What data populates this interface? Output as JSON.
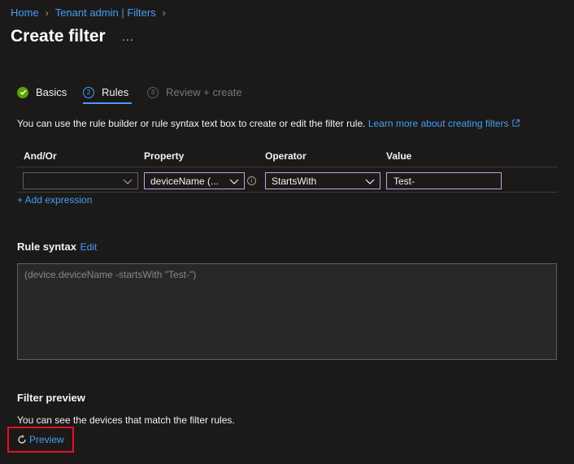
{
  "breadcrumb": {
    "home": "Home",
    "section": "Tenant admin | Filters"
  },
  "page": {
    "title": "Create filter",
    "more": "..."
  },
  "steps": [
    {
      "number": "✓",
      "label": "Basics",
      "state": "done"
    },
    {
      "number": "2",
      "label": "Rules",
      "state": "current"
    },
    {
      "number": "3",
      "label": "Review + create",
      "state": "pending"
    }
  ],
  "description": {
    "text": "You can use the rule builder or rule syntax text box to create or edit the filter rule.",
    "link": "Learn more about creating filters"
  },
  "rule_table": {
    "headers": [
      "And/Or",
      "Property",
      "Operator",
      "Value"
    ],
    "row": {
      "and_or": "",
      "property": "deviceName (...",
      "operator": "StartsWith",
      "value": "Test-"
    },
    "add_expression": "+ Add expression"
  },
  "rule_syntax": {
    "title": "Rule syntax",
    "edit": "Edit",
    "text": "(device.deviceName -startsWith \"Test-\")"
  },
  "filter_preview": {
    "title": "Filter preview",
    "description": "You can see the devices that match the filter rules.",
    "button": "Preview"
  },
  "colors": {
    "background": "#1b1a19",
    "link": "#479ef5",
    "success": "#57a300",
    "highlight_border": "#e81123",
    "focus_border": "#c8a0e8"
  }
}
